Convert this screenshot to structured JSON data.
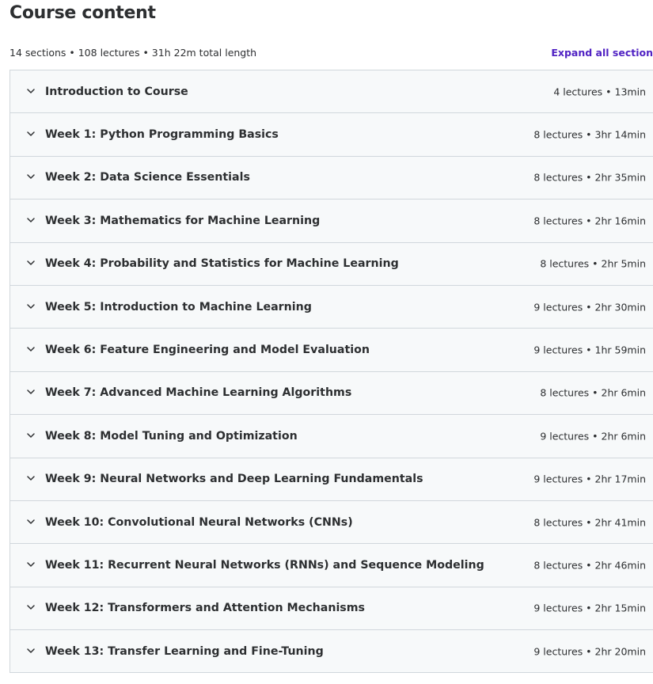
{
  "header": {
    "title": "Course content",
    "summary": "14 sections • 108 lectures • 31h 22m total length",
    "expand_all_label": "Expand all section"
  },
  "icons": {
    "chevron": "chevron-down-icon"
  },
  "colors": {
    "accent": "#5022c3",
    "text": "#2d2f31",
    "section_bg": "#f7f9fa",
    "border": "#d1d7dc"
  },
  "sections": [
    {
      "title": "Introduction to Course",
      "meta": "4 lectures • 13min"
    },
    {
      "title": "Week 1: Python Programming Basics",
      "meta": "8 lectures • 3hr 14min"
    },
    {
      "title": "Week 2: Data Science Essentials",
      "meta": "8 lectures • 2hr 35min"
    },
    {
      "title": "Week 3: Mathematics for Machine Learning",
      "meta": "8 lectures • 2hr 16min"
    },
    {
      "title": "Week 4: Probability and Statistics for Machine Learning",
      "meta": "8 lectures • 2hr 5min"
    },
    {
      "title": "Week 5: Introduction to Machine Learning",
      "meta": "9 lectures • 2hr 30min"
    },
    {
      "title": "Week 6: Feature Engineering and Model Evaluation",
      "meta": "9 lectures • 1hr 59min"
    },
    {
      "title": "Week 7: Advanced Machine Learning Algorithms",
      "meta": "8 lectures • 2hr 6min"
    },
    {
      "title": "Week 8: Model Tuning and Optimization",
      "meta": "9 lectures • 2hr 6min"
    },
    {
      "title": "Week 9: Neural Networks and Deep Learning Fundamentals",
      "meta": "9 lectures • 2hr 17min"
    },
    {
      "title": "Week 10: Convolutional Neural Networks (CNNs)",
      "meta": "8 lectures • 2hr 41min"
    },
    {
      "title": "Week 11: Recurrent Neural Networks (RNNs) and Sequence Modeling",
      "meta": "8 lectures • 2hr 46min"
    },
    {
      "title": "Week 12: Transformers and Attention Mechanisms",
      "meta": "9 lectures • 2hr 15min"
    },
    {
      "title": "Week 13: Transfer Learning and Fine-Tuning",
      "meta": "9 lectures • 2hr 20min"
    }
  ]
}
